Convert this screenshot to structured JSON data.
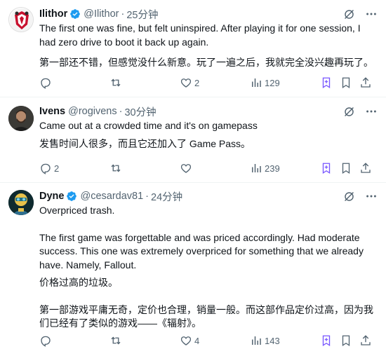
{
  "tweets": [
    {
      "name": "Ilithor",
      "verified": true,
      "handle": "@Ilithor",
      "time": "25分钟",
      "paragraphs": [
        "The first one was fine, but felt uninspired. After playing it for one session, I had zero drive to boot it back up again.",
        "第一部还不错，但感觉没什么新意。玩了一遍之后，我就完全没兴趣再玩了。"
      ],
      "replies": "",
      "reposts": "",
      "likes": "2",
      "views": "129"
    },
    {
      "name": "Ivens",
      "verified": false,
      "handle": "@rogivens",
      "time": "30分钟",
      "paragraphs": [
        "Came out at a crowded time and it's on gamepass",
        "发售时间人很多，而且它还加入了 Game Pass。"
      ],
      "replies": "2",
      "reposts": "",
      "likes": "",
      "views": "239"
    },
    {
      "name": "Dyne",
      "verified": true,
      "handle": "@cesardav81",
      "time": "24分钟",
      "paragraphs": [
        "Overpriced trash.",
        "The first game was forgettable and was priced accordingly. Had moderate success. This one was extremely overpriced for something that we already have. Namely, Fallout.",
        "价格过高的垃圾。",
        "第一部游戏平庸无奇，定价也合理，销量一般。而这部作品定价过高，因为我们已经有了类似的游戏——《辐射》。"
      ],
      "replies": "",
      "reposts": "",
      "likes": "4",
      "views": "143"
    }
  ],
  "colors": {
    "text": "#0f1419",
    "secondary": "#536471",
    "verified": "#1d9bf0",
    "bookmark_accent": "#7856ff"
  },
  "icons": [
    "grok-icon",
    "more-icon",
    "reply-icon",
    "repost-icon",
    "like-icon",
    "views-icon",
    "bookmark-plus-icon",
    "bookmark-icon",
    "share-icon",
    "verified-badge-icon"
  ]
}
